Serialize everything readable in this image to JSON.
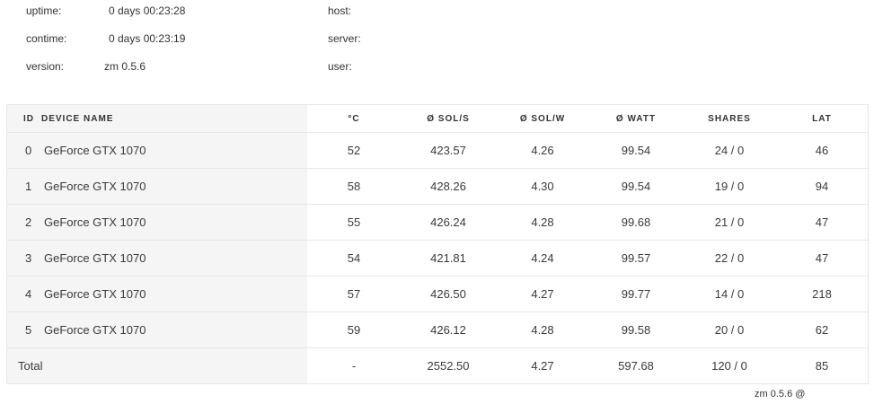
{
  "stats": {
    "uptime_label": "uptime:",
    "uptime_value": "0 days  00:23:28",
    "contime_label": "contime:",
    "contime_value": "0 days  00:23:19",
    "version_label": "version:",
    "version_value": "zm 0.5.6",
    "host_label": "host:",
    "server_label": "server:",
    "user_label": "user:"
  },
  "table": {
    "headers": [
      "ID",
      "DEVICE NAME",
      "°C",
      "Ø SOL/S",
      "Ø SOL/W",
      "Ø WATT",
      "SHARES",
      "LAT"
    ],
    "rows": [
      [
        "0",
        "GeForce GTX 1070",
        "52",
        "423.57",
        "4.26",
        "99.54",
        "24 / 0",
        "46"
      ],
      [
        "1",
        "GeForce GTX 1070",
        "58",
        "428.26",
        "4.30",
        "99.54",
        "19 / 0",
        "94"
      ],
      [
        "2",
        "GeForce GTX 1070",
        "55",
        "426.24",
        "4.28",
        "99.68",
        "21 / 0",
        "47"
      ],
      [
        "3",
        "GeForce GTX 1070",
        "54",
        "421.81",
        "4.24",
        "99.57",
        "22 / 0",
        "47"
      ],
      [
        "4",
        "GeForce GTX 1070",
        "57",
        "426.50",
        "4.27",
        "99.77",
        "14 / 0",
        "218"
      ],
      [
        "5",
        "GeForce GTX 1070",
        "59",
        "426.12",
        "4.28",
        "99.58",
        "20 / 0",
        "62"
      ]
    ],
    "total": {
      "label": "Total",
      "temp": "-",
      "sol_s": "2552.50",
      "sol_w": "4.27",
      "watt": "597.68",
      "shares": "120 / 0",
      "lat": "85"
    }
  },
  "footer": {
    "text": "zm 0.5.6 @"
  },
  "colors": {
    "left_column_bg": "#f5f5f5",
    "border": "#e6e6e6",
    "text": "#3a3a3a"
  }
}
